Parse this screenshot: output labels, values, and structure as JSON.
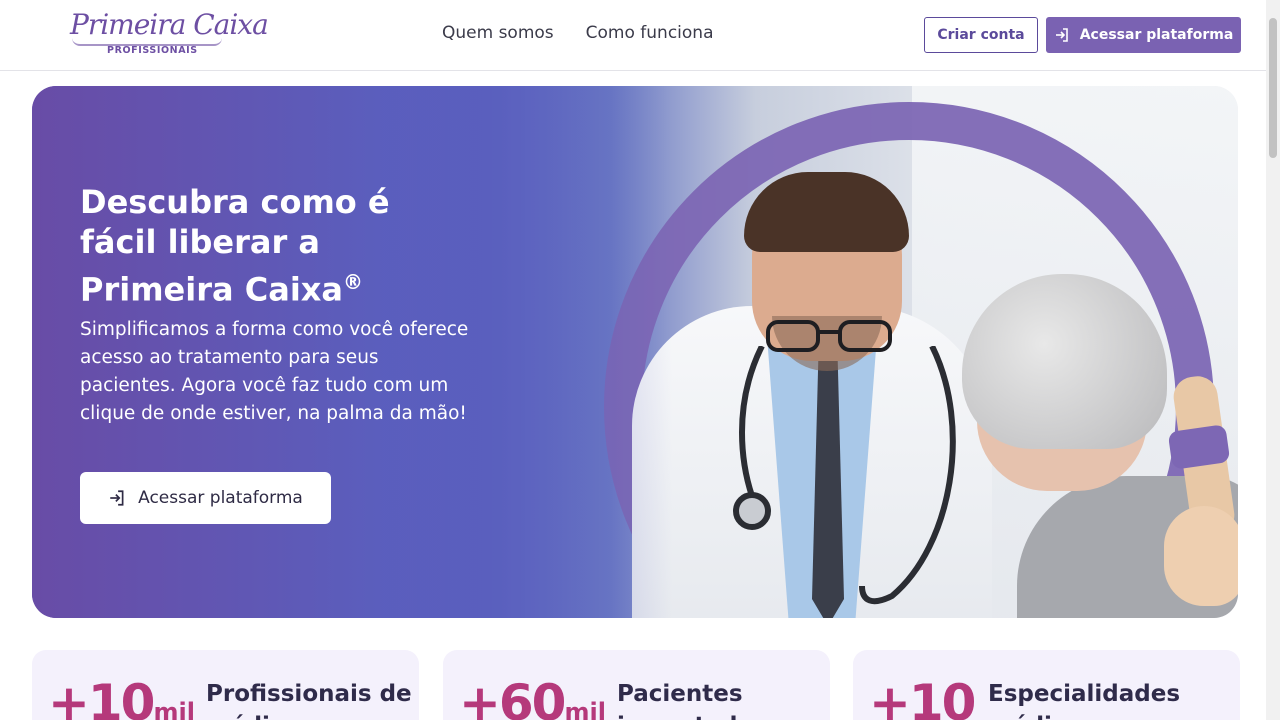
{
  "header": {
    "logo_script": "Primeira Caixa",
    "logo_sub": "PROFISSIONAIS",
    "nav": [
      "Quem somos",
      "Como funciona"
    ],
    "create_account_label": "Criar conta",
    "access_label": "Acessar plataforma"
  },
  "hero": {
    "title": "Descubra como é fácil liberar a Primeira Caixa",
    "title_mark": "®",
    "text": "Simplificamos a forma como você oferece acesso ao tratamento para seus pacientes. Agora você faz tudo com um clique de onde estiver, na palma da mão!",
    "button_label": "Acessar plataforma"
  },
  "stats": [
    {
      "number": "+10",
      "unit": "mil",
      "label": "Profissionais de médicos"
    },
    {
      "number": "+60",
      "unit": "mil",
      "label": "Pacientes impactados"
    },
    {
      "number": "+10",
      "unit": "",
      "label": "Especialidades médicas"
    }
  ],
  "icons": {
    "login": "login-arrow-icon"
  },
  "colors": {
    "brand_purple": "#7a62b2",
    "accent_magenta": "#b5397b",
    "stat_bg": "#f4f1fc"
  }
}
